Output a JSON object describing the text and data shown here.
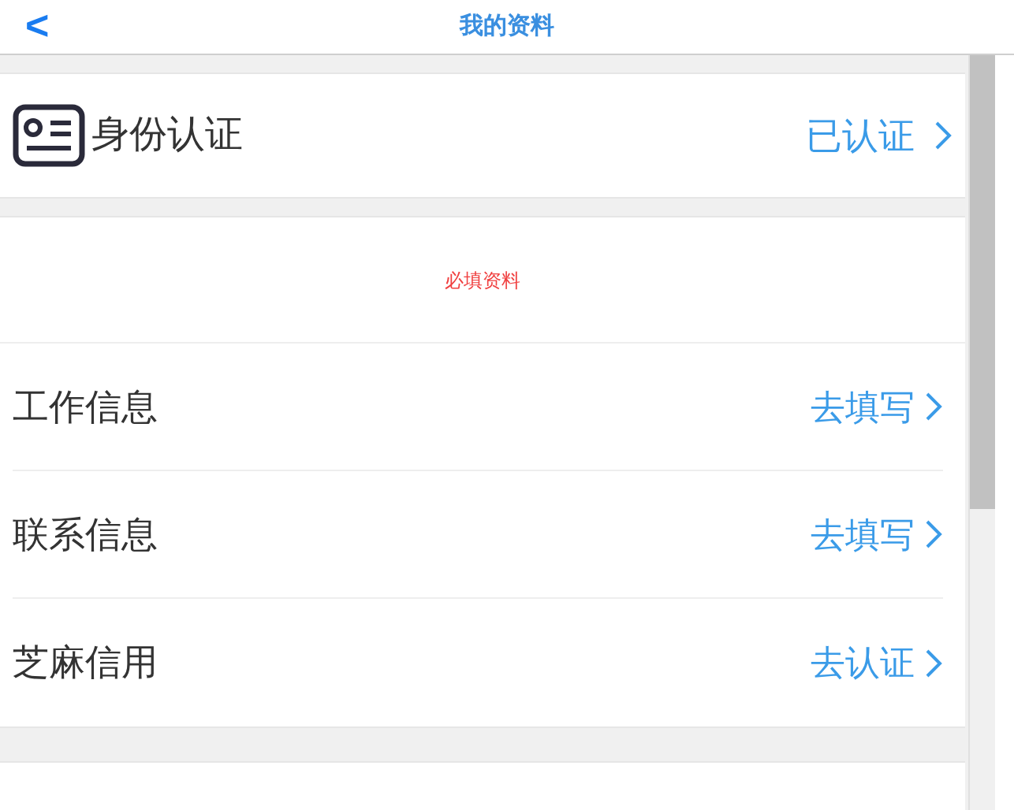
{
  "header": {
    "back": "<",
    "title": "我的资料"
  },
  "identity": {
    "label": "身份认证",
    "status": "已认证"
  },
  "required": {
    "title": "必填资料",
    "items": [
      {
        "label": "工作信息",
        "action": "去填写"
      },
      {
        "label": "联系信息",
        "action": "去填写"
      },
      {
        "label": "芝麻信用",
        "action": "去认证"
      }
    ]
  }
}
